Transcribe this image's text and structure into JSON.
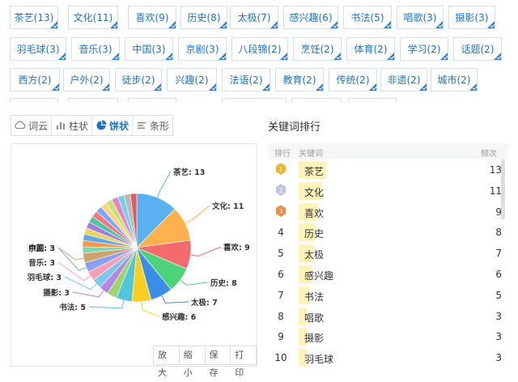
{
  "tag_rows": [
    [
      {
        "label": "茶艺(13)"
      },
      {
        "label": "文化(11)"
      },
      {
        "label": "喜欢(9)"
      },
      {
        "label": "历史(8)"
      },
      {
        "label": "太极(7)"
      },
      {
        "label": "感兴趣(6)"
      },
      {
        "label": "书法(5)"
      },
      {
        "label": "唱歌(3)"
      },
      {
        "label": "摄影(3)"
      }
    ],
    [
      {
        "label": "羽毛球(3)"
      },
      {
        "label": "音乐(3)"
      },
      {
        "label": "中国(3)"
      },
      {
        "label": "京剧(3)"
      },
      {
        "label": "八段锦(2)"
      },
      {
        "label": "烹饪(2)"
      },
      {
        "label": "体育(2)"
      },
      {
        "label": "学习(2)"
      },
      {
        "label": "话题(2)"
      }
    ],
    [
      {
        "label": "西方(2)"
      },
      {
        "label": "户外(2)"
      },
      {
        "label": "徒步(2)"
      },
      {
        "label": "兴趣(2)"
      },
      {
        "label": "法语(2)"
      },
      {
        "label": "教育(2)"
      },
      {
        "label": "传统(2)"
      },
      {
        "label": "非遗(2)"
      },
      {
        "label": "城市(2)"
      }
    ]
  ],
  "view_tabs": [
    {
      "label": "词云",
      "icon": "cloud-icon"
    },
    {
      "label": "柱状",
      "icon": "bar-chart-icon"
    },
    {
      "label": "饼状",
      "icon": "pie-chart-icon",
      "active": true
    },
    {
      "label": "条形",
      "icon": "list-icon"
    }
  ],
  "chart_actions": [
    "放大",
    "缩小",
    "保存",
    "打印"
  ],
  "ranking": {
    "title": "关键词排行",
    "headers": {
      "rank": "排行",
      "keyword": "关键词",
      "freq": "频次"
    },
    "rows": [
      {
        "rank": "1",
        "keyword": "茶艺",
        "freq": "13",
        "medal": "gold"
      },
      {
        "rank": "2",
        "keyword": "文化",
        "freq": "11",
        "medal": "silver"
      },
      {
        "rank": "3",
        "keyword": "喜欢",
        "freq": "9",
        "medal": "bronze"
      },
      {
        "rank": "4",
        "keyword": "历史",
        "freq": "8"
      },
      {
        "rank": "5",
        "keyword": "太极",
        "freq": "7"
      },
      {
        "rank": "6",
        "keyword": "感兴趣",
        "freq": "6"
      },
      {
        "rank": "7",
        "keyword": "书法",
        "freq": "5"
      },
      {
        "rank": "8",
        "keyword": "唱歌",
        "freq": "3"
      },
      {
        "rank": "9",
        "keyword": "摄影",
        "freq": "3"
      },
      {
        "rank": "10",
        "keyword": "羽毛球",
        "freq": "3"
      }
    ]
  },
  "colors": {
    "accent": "#1a73c8",
    "tag_border": "#cfe0f2",
    "bar": "#fff3b8"
  },
  "chart_data": {
    "type": "pie",
    "slices": [
      {
        "name": "茶艺",
        "value": 13,
        "label": "茶艺: 13",
        "color": "#5ab1ef"
      },
      {
        "name": "文化",
        "value": 11,
        "label": "文化: 11",
        "color": "#ffb14e"
      },
      {
        "name": "喜欢",
        "value": 9,
        "label": "喜欢: 9",
        "color": "#f36c6c"
      },
      {
        "name": "历史",
        "value": 8,
        "label": "历史: 8",
        "color": "#4cd37a"
      },
      {
        "name": "太极",
        "value": 7,
        "label": "太极: 7",
        "color": "#3a8ee6"
      },
      {
        "name": "感兴趣",
        "value": 6,
        "label": "感兴趣: 6",
        "color": "#f9cf24"
      },
      {
        "name": "书法",
        "value": 5,
        "label": "书法: 5",
        "color": "#53c7d9"
      },
      {
        "name": "唱歌",
        "value": 3,
        "color": "#9fd36b"
      },
      {
        "name": "摄影",
        "value": 3,
        "label": "摄影: 3",
        "color": "#b387e0"
      },
      {
        "name": "羽毛球",
        "value": 3,
        "label": "羽毛球: 3",
        "color": "#7ec6f0"
      },
      {
        "name": "音乐",
        "value": 3,
        "label": "音乐: 3",
        "color": "#f6a0b8"
      },
      {
        "name": "中国",
        "value": 3,
        "label": "中国: 3",
        "color": "#8a9ff0"
      },
      {
        "name": "京剧",
        "value": 3,
        "label": "京剧: 3",
        "color": "#cfa46c"
      },
      {
        "name": "八段锦",
        "value": 2,
        "color": "#7fd7b5"
      },
      {
        "name": "烹饪",
        "value": 2,
        "color": "#f39c50"
      },
      {
        "name": "体育",
        "value": 2,
        "color": "#60a7e8"
      },
      {
        "name": "学习",
        "value": 2,
        "color": "#e6d460"
      },
      {
        "name": "话题",
        "value": 2,
        "color": "#a57cd8"
      },
      {
        "name": "西方",
        "value": 2,
        "color": "#4fc4a0"
      },
      {
        "name": "户外",
        "value": 2,
        "color": "#f07a7a"
      },
      {
        "name": "徒步",
        "value": 2,
        "color": "#7aa7ff"
      },
      {
        "name": "兴趣",
        "value": 2,
        "color": "#ffd37f"
      },
      {
        "name": "法语",
        "value": 2,
        "color": "#c8e07a"
      },
      {
        "name": "教育",
        "value": 2,
        "color": "#e67ec8"
      },
      {
        "name": "传统",
        "value": 2,
        "color": "#70d2e6"
      },
      {
        "name": "非遗",
        "value": 2,
        "color": "#b9b9b9"
      },
      {
        "name": "城市",
        "value": 2,
        "color": "#e45a5a"
      }
    ]
  }
}
